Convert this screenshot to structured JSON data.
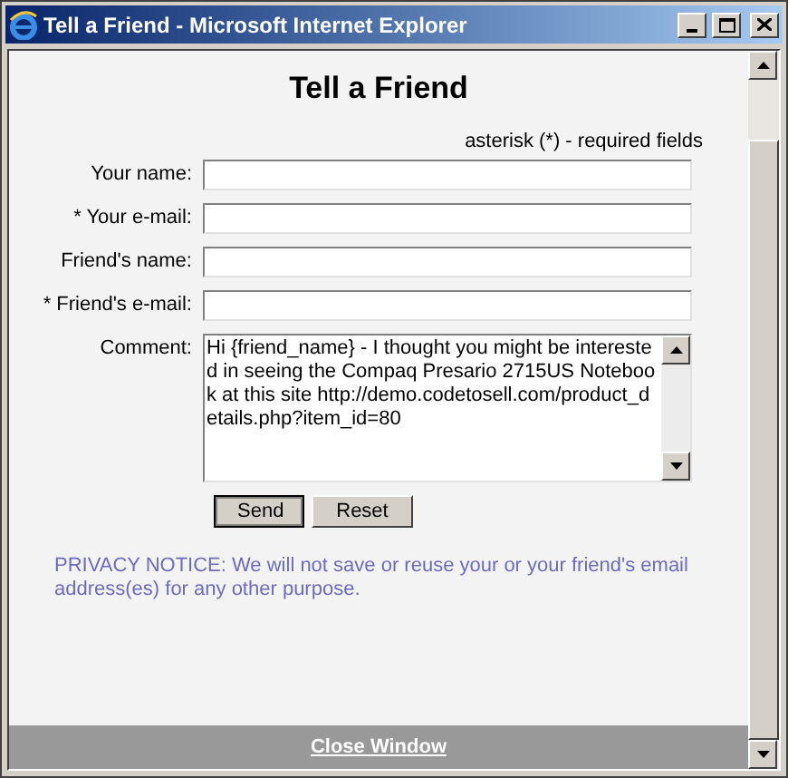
{
  "window": {
    "title": "Tell a Friend - Microsoft Internet Explorer"
  },
  "heading": "Tell a Friend",
  "required_note": "asterisk (*) - required fields",
  "fields": [
    {
      "label": "Your name:"
    },
    {
      "label": "* Your e-mail:"
    },
    {
      "label": "Friend's name:"
    },
    {
      "label": "* Friend's e-mail:"
    }
  ],
  "comment": {
    "label": "Comment:",
    "value": "Hi {friend_name} - I thought you might be interested in seeing the Compaq Presario 2715US Notebook at this site http://demo.codetosell.com/product_details.php?item_id=80"
  },
  "buttons": [
    {
      "label": "Send",
      "selected": true
    },
    {
      "label": "Reset",
      "selected": false
    }
  ],
  "privacy_notice": "PRIVACY NOTICE: We will not save or reuse your or your friend's email address(es) for any other purpose.",
  "footer_link": "Close Window"
}
